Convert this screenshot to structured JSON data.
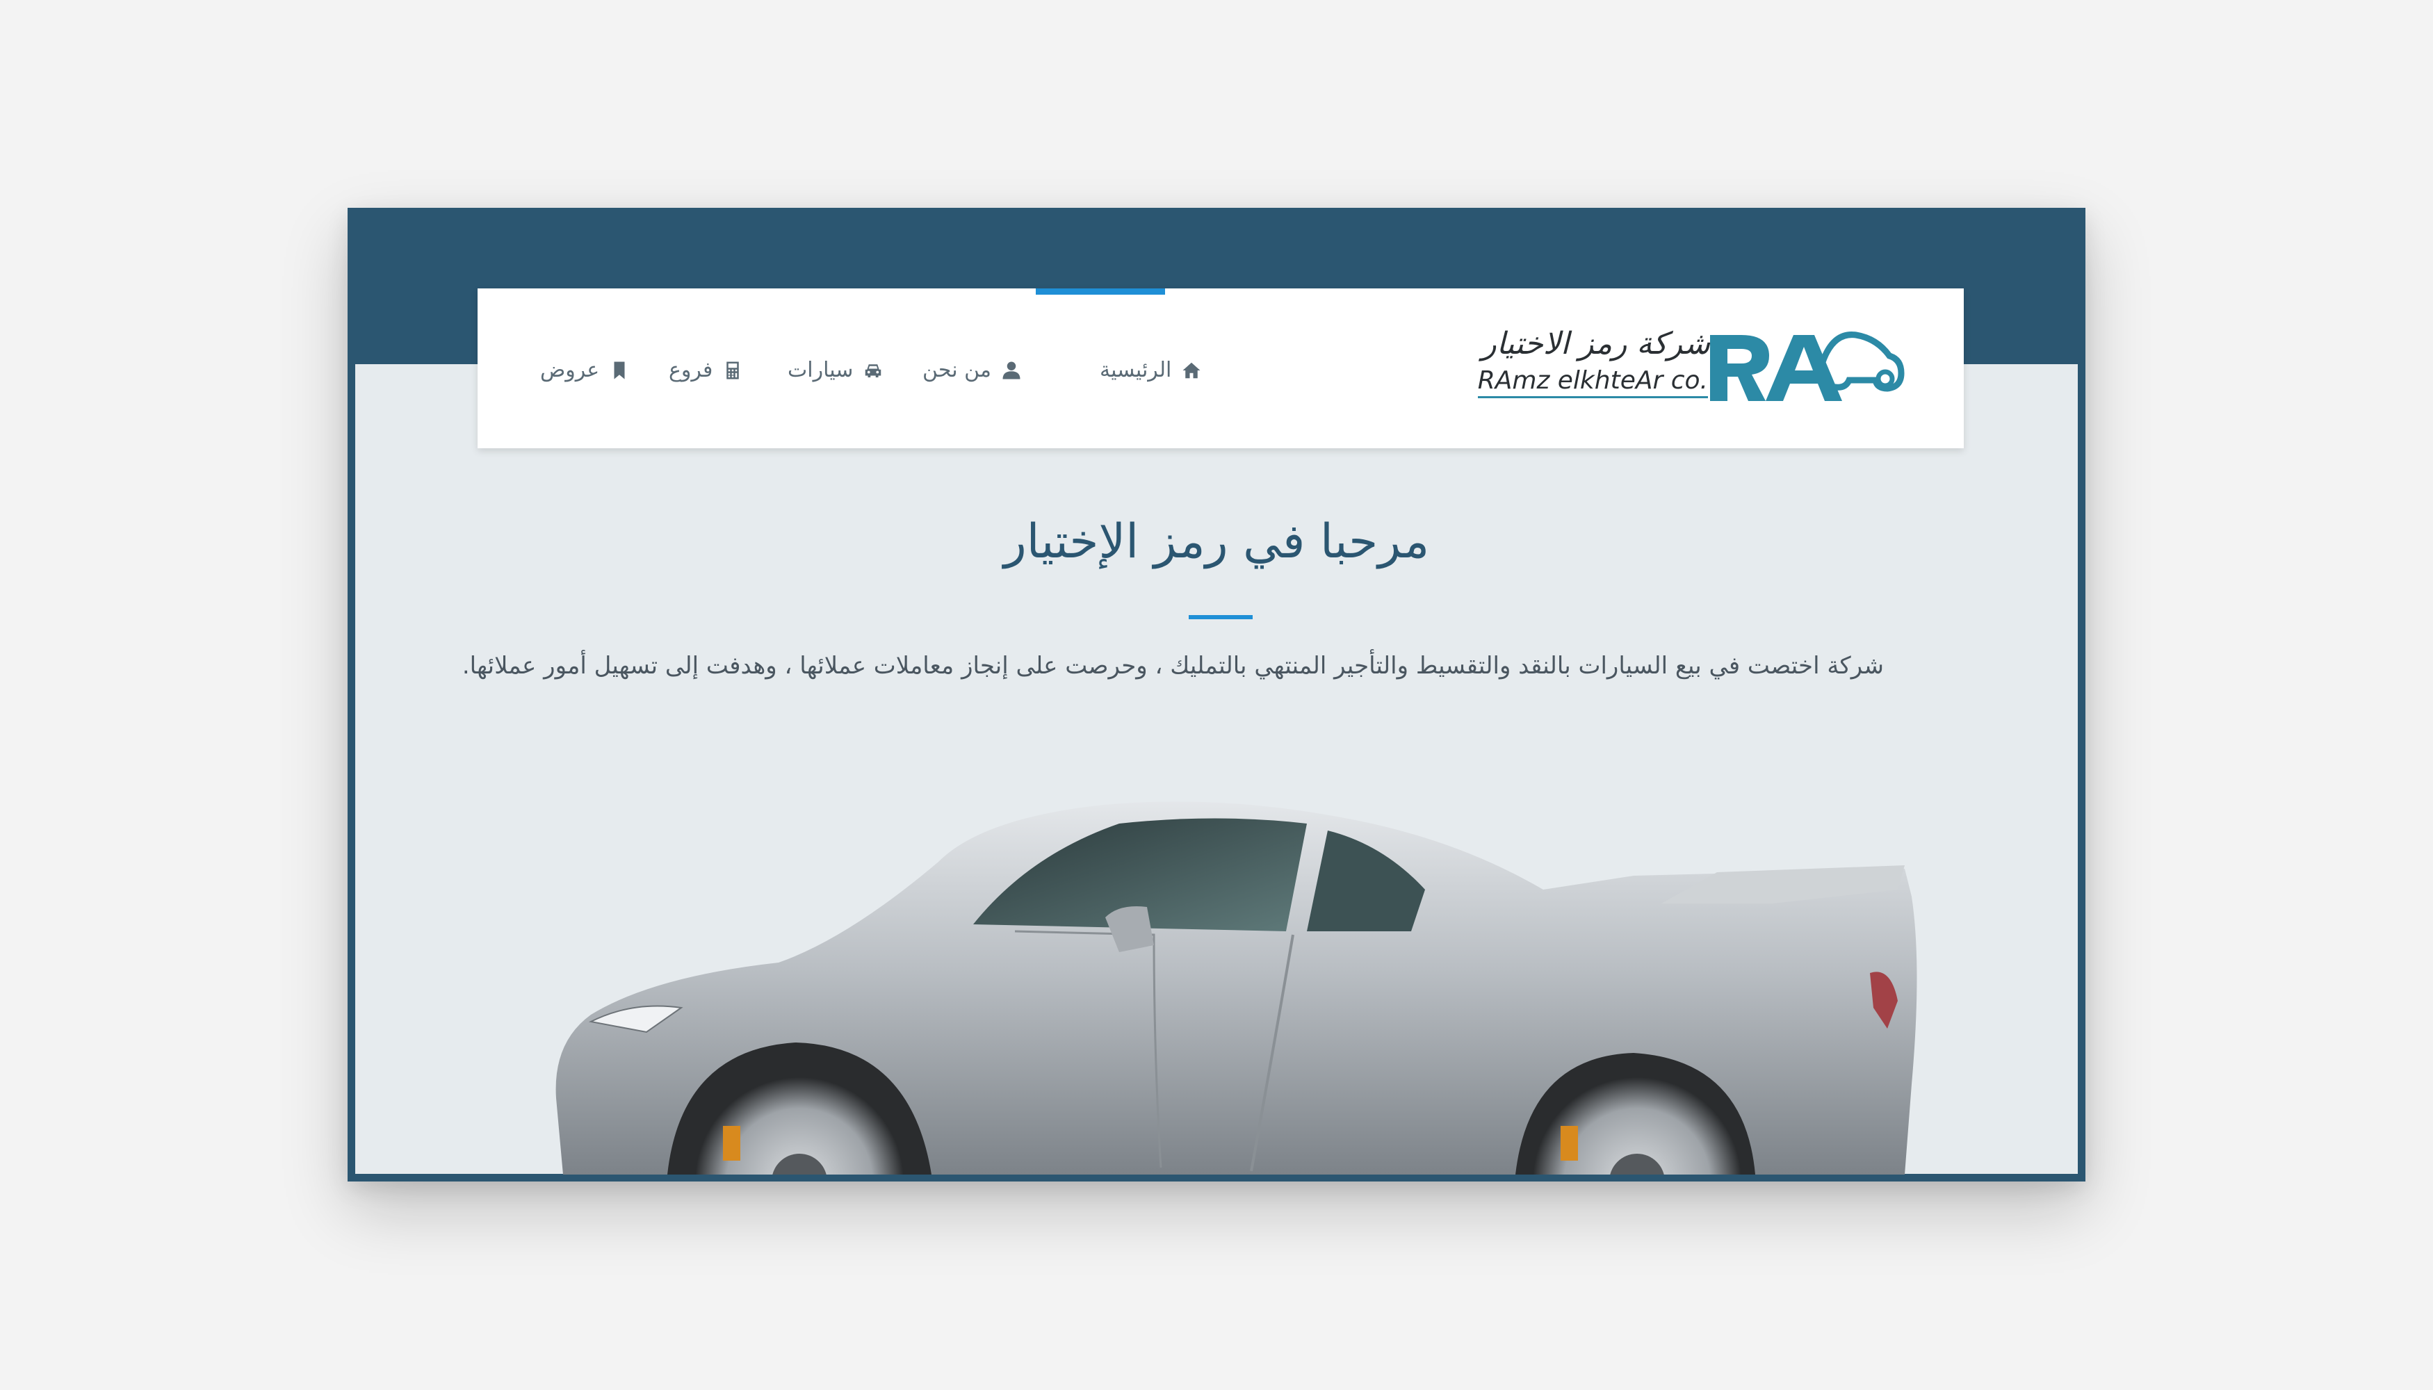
{
  "brand": {
    "name_ar": "شركة رمز الاختيار",
    "name_en": "RAmz elkhteAr co.",
    "color_primary": "#2b5671",
    "color_accent": "#1f8fd6",
    "color_logo": "#2c8aa6"
  },
  "nav": {
    "items": [
      {
        "label": "الرئيسية",
        "icon": "home-icon",
        "active": true
      },
      {
        "label": "من نحن",
        "icon": "user-icon",
        "active": false
      },
      {
        "label": "سيارات",
        "icon": "car-icon",
        "active": false
      },
      {
        "label": "فروع",
        "icon": "calculator-icon",
        "active": false
      },
      {
        "label": "عروض",
        "icon": "bookmark-icon",
        "active": false
      }
    ]
  },
  "hero": {
    "title": "مرحبا في رمز الإختيار",
    "description": "شركة اختصت في بيع السيارات بالنقد والتقسيط والتأجير المنتهي بالتمليك ، وحرصت على إنجاز معاملات عملائها ، وهدفت إلى تسهيل أمور عملائها."
  }
}
